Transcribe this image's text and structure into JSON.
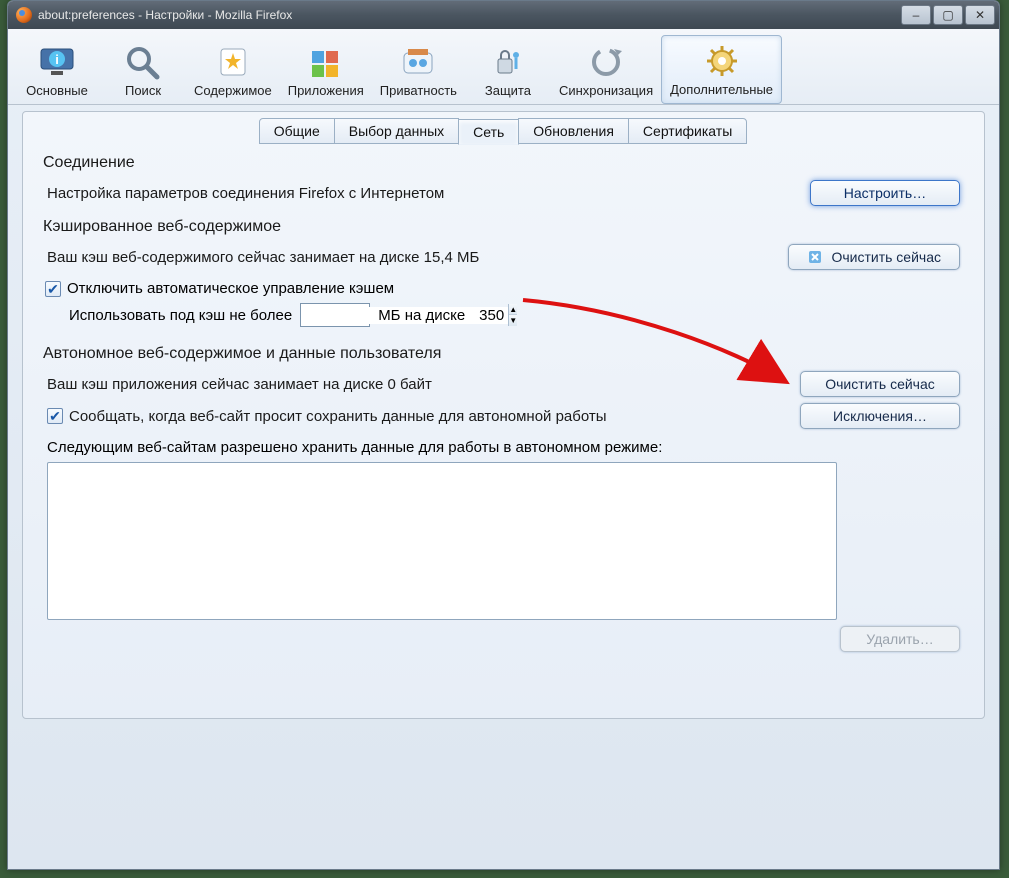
{
  "titlebar": {
    "text": "about:preferences - Настройки - Mozilla Firefox"
  },
  "toolbar": [
    {
      "id": "general",
      "label": "Основные"
    },
    {
      "id": "search",
      "label": "Поиск"
    },
    {
      "id": "content",
      "label": "Содержимое"
    },
    {
      "id": "applications",
      "label": "Приложения"
    },
    {
      "id": "privacy",
      "label": "Приватность"
    },
    {
      "id": "security",
      "label": "Защита"
    },
    {
      "id": "sync",
      "label": "Синхронизация"
    },
    {
      "id": "advanced",
      "label": "Дополнительные"
    }
  ],
  "subtabs": [
    {
      "id": "general",
      "label": "Общие"
    },
    {
      "id": "datachoice",
      "label": "Выбор данных"
    },
    {
      "id": "network",
      "label": "Сеть"
    },
    {
      "id": "updates",
      "label": "Обновления"
    },
    {
      "id": "certs",
      "label": "Сертификаты"
    }
  ],
  "connection": {
    "title": "Соединение",
    "desc": "Настройка параметров соединения Firefox с Интернетом",
    "configure_btn": "Настроить…"
  },
  "webcache": {
    "title": "Кэшированное веб-содержимое",
    "status": "Ваш кэш веб-содержимого сейчас занимает на диске 15,4 МБ",
    "clear_btn": "Очистить сейчас",
    "override_chk": "Отключить автоматическое управление кэшем",
    "limit_before": "Использовать под кэш не более",
    "limit_value": "350",
    "limit_after": "МБ на диске"
  },
  "offline": {
    "title": "Автономное веб-содержимое и данные пользователя",
    "status": "Ваш кэш приложения сейчас занимает на диске 0 байт",
    "clear_btn": "Очистить сейчас",
    "notify_chk": "Сообщать, когда веб-сайт просит сохранить данные для автономной работы",
    "exceptions_btn": "Исключения…",
    "list_label": "Следующим веб-сайтам разрешено хранить данные для работы в автономном режиме:",
    "remove_btn": "Удалить…"
  }
}
